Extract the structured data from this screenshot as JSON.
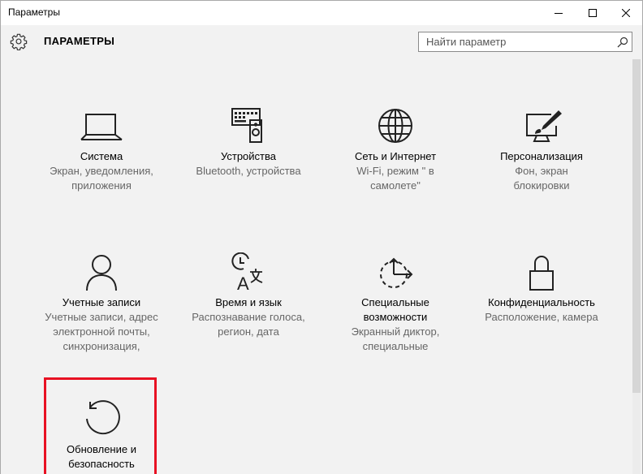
{
  "window": {
    "title": "Параметры",
    "heading": "ПАРАМЕТРЫ",
    "search_placeholder": "Найти параметр"
  },
  "tiles": [
    {
      "label": "Система",
      "desc": [
        "Экран, уведомления,",
        "приложения"
      ],
      "icon": "laptop-icon"
    },
    {
      "label": "Устройства",
      "desc": [
        "Bluetooth, устройства"
      ],
      "icon": "keyboard-speaker-icon"
    },
    {
      "label": "Сеть и Интернет",
      "desc": [
        "Wi-Fi, режим \" в",
        "самолете\""
      ],
      "icon": "globe-icon"
    },
    {
      "label": "Персонализация",
      "desc": [
        "Фон, экран",
        "блокировки"
      ],
      "icon": "paint-screen-icon"
    },
    {
      "label": "Учетные записи",
      "desc": [
        "Учетные записи, адрес",
        "электронной почты,",
        "синхронизация,"
      ],
      "icon": "person-icon"
    },
    {
      "label": "Время и язык",
      "desc": [
        "Распознавание голоса,",
        "регион, дата"
      ],
      "icon": "clock-language-icon"
    },
    {
      "label": [
        "Специальные",
        "возможности"
      ],
      "desc": [
        "Экранный диктор,",
        "специальные"
      ],
      "icon": "ease-of-access-icon"
    },
    {
      "label": "Конфиденциальность",
      "desc": [
        "Расположение, камера"
      ],
      "icon": "lock-icon"
    },
    {
      "label": [
        "Обновление и",
        "безопасность"
      ],
      "desc": [],
      "icon": "refresh-icon",
      "highlighted": true
    }
  ],
  "colors": {
    "highlight": "#e81123",
    "text": "#000000",
    "desc": "#666666"
  }
}
